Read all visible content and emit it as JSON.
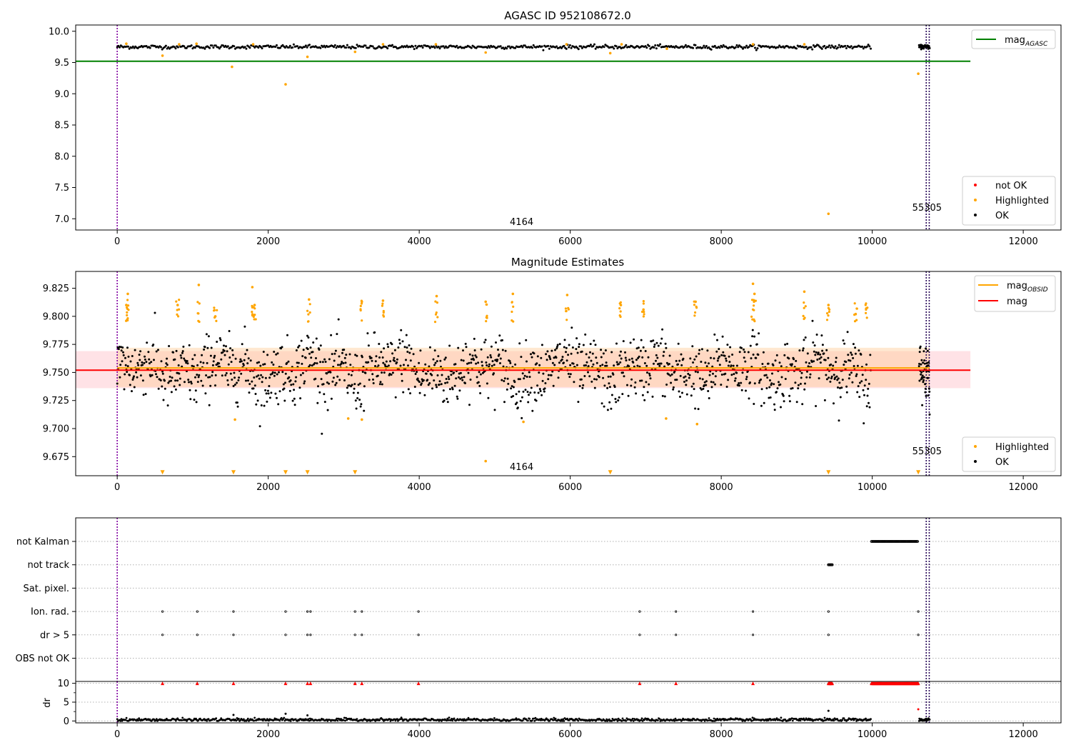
{
  "chart_data": [
    {
      "type": "scatter",
      "title": "AGASC ID 952108672.0",
      "xlim": [
        -550,
        12500
      ],
      "ylim": [
        6.82,
        10.1
      ],
      "xticks": [
        0,
        2000,
        4000,
        6000,
        8000,
        10000,
        12000
      ],
      "xtick_labels": [
        "0",
        "2000",
        "4000",
        "6000",
        "8000",
        "10000",
        "12000"
      ],
      "yticks": [
        7.0,
        7.5,
        8.0,
        8.5,
        9.0,
        9.5,
        10.0
      ],
      "ytick_labels": [
        "7.0",
        "7.5",
        "8.0",
        "8.5",
        "9.0",
        "9.5",
        "10.0"
      ],
      "grid": false,
      "vlines": [
        0,
        10715,
        10755
      ],
      "annotations": [
        {
          "text": "4164",
          "x": 5200,
          "y": 6.9
        },
        {
          "text": "55305",
          "x": 10530,
          "y": 7.13
        }
      ],
      "lines": [
        {
          "name": "magAGASC",
          "label_main": "mag",
          "label_sub": "AGASC",
          "color": "#008000",
          "x": [
            -550,
            11300
          ],
          "y": 9.52
        }
      ],
      "legend_upper": {
        "placement": "upper-right",
        "entries": [
          {
            "label_main": "mag",
            "label_sub": "AGASC",
            "color": "#008000"
          }
        ]
      },
      "legend_lower": {
        "placement": "lower-right",
        "entries": [
          {
            "label": "not OK",
            "color": "#ff0000"
          },
          {
            "label": "Highlighted",
            "color": "#ffa500"
          },
          {
            "label": "OK",
            "color": "#000000"
          }
        ]
      },
      "series": [
        {
          "name": "OK",
          "color": "#000000",
          "x_range": [
            0,
            9980
          ],
          "gap_range": [
            10620,
            10760
          ],
          "level": 9.75,
          "spread": 0.015
        },
        {
          "name": "Highlighted",
          "color": "#ffa500",
          "x": [
            120,
            600,
            820,
            1050,
            1520,
            1800,
            2230,
            2520,
            3150,
            3520,
            4220,
            4880,
            5950,
            6530,
            6680,
            7280,
            8420,
            9100,
            9420,
            10610
          ],
          "y": [
            9.8,
            9.61,
            9.79,
            9.8,
            9.43,
            9.79,
            9.15,
            9.59,
            9.67,
            9.79,
            9.79,
            9.66,
            9.79,
            9.65,
            9.79,
            9.72,
            9.79,
            9.79,
            7.08,
            9.32
          ]
        }
      ]
    },
    {
      "type": "scatter",
      "title": "Magnitude Estimates",
      "xlim": [
        -550,
        12500
      ],
      "ylim": [
        9.658,
        9.84
      ],
      "xticks": [
        0,
        2000,
        4000,
        6000,
        8000,
        10000,
        12000
      ],
      "xtick_labels": [
        "0",
        "2000",
        "4000",
        "6000",
        "8000",
        "10000",
        "12000"
      ],
      "yticks": [
        9.675,
        9.7,
        9.725,
        9.75,
        9.775,
        9.8,
        9.825
      ],
      "ytick_labels": [
        "9.675",
        "9.700",
        "9.725",
        "9.750",
        "9.775",
        "9.800",
        "9.825"
      ],
      "grid": false,
      "vlines": [
        0,
        10715,
        10755
      ],
      "annotations": [
        {
          "text": "4164",
          "x": 5200,
          "y": 9.663
        },
        {
          "text": "55305",
          "x": 10530,
          "y": 9.677
        }
      ],
      "lines": [
        {
          "name": "magOBSID",
          "label_main": "mag",
          "label_sub": "OBSID",
          "color": "#ffa500",
          "x": [
            0,
            10760
          ],
          "y": 9.754
        },
        {
          "name": "mag",
          "label_main": "mag",
          "color": "#ff0000",
          "x": [
            -550,
            11300
          ],
          "y": 9.752
        }
      ],
      "bands": [
        {
          "name": "mag band",
          "color": "#ffb6c1",
          "x": [
            -550,
            11300
          ],
          "y": [
            9.736,
            9.769
          ]
        },
        {
          "name": "magOBSID band",
          "color": "#ffcc99",
          "x": [
            0,
            10760
          ],
          "y": [
            9.737,
            9.772
          ]
        }
      ],
      "legend_upper": {
        "placement": "upper-right",
        "entries": [
          {
            "label_main": "mag",
            "label_sub": "OBSID",
            "color": "#ffa500"
          },
          {
            "label_main": "mag",
            "label_sub": "",
            "color": "#ff0000"
          }
        ]
      },
      "legend_lower": {
        "placement": "lower-right",
        "entries": [
          {
            "label": "Highlighted",
            "color": "#ffa500"
          },
          {
            "label": "OK",
            "color": "#000000"
          }
        ]
      },
      "series": [
        {
          "name": "OK",
          "color": "#000000",
          "x_range": [
            0,
            9980
          ],
          "gap_range": [
            10620,
            10760
          ],
          "level": 9.752,
          "spread": 0.014
        },
        {
          "name": "Highlighted",
          "color": "#ffa500",
          "x": [
            120,
            140,
            800,
            1080,
            1300,
            1790,
            1820,
            2540,
            3240,
            3520,
            4230,
            4880,
            5240,
            5960,
            6670,
            6970,
            7660,
            8420,
            8440,
            9100,
            9420,
            9780,
            9920,
            1560,
            3060,
            3240,
            5380,
            7270,
            7680,
            4880
          ],
          "y": [
            9.81,
            9.82,
            9.81,
            9.828,
            9.8,
            9.826,
            9.81,
            9.815,
            9.813,
            9.814,
            9.818,
            9.813,
            9.82,
            9.819,
            9.81,
            9.806,
            9.813,
            9.829,
            9.82,
            9.822,
            9.81,
            9.802,
            9.807,
            9.708,
            9.709,
            9.708,
            9.706,
            9.709,
            9.704,
            9.671
          ]
        },
        {
          "name": "Highlighted (below range)",
          "color": "#ffa500",
          "marker": "triangle-down",
          "x": [
            600,
            1540,
            2230,
            2520,
            3150,
            6530,
            9420,
            10610
          ],
          "y": 9.661
        }
      ]
    },
    {
      "type": "scatter",
      "title": "",
      "xlim": [
        -550,
        12500
      ],
      "categories": [
        "not Kalman",
        "not track",
        "Sat. pixel.",
        "Ion. rad.",
        "dr > 5",
        "OBS not OK"
      ],
      "grid": "horizontal-dotted",
      "vlines": [
        0,
        10715,
        10755
      ],
      "flags": [
        {
          "category": "not Kalman",
          "x_range": [
            9990,
            10600
          ]
        },
        {
          "category": "not track",
          "x_range": [
            9420,
            9470
          ]
        },
        {
          "category": "Ion. rad.",
          "x": [
            600,
            1060,
            1540,
            2230,
            2520,
            2560,
            3150,
            3240,
            3990,
            6920,
            7400,
            8420,
            9420,
            10610
          ]
        },
        {
          "category": "dr > 5",
          "x": [
            600,
            1060,
            1540,
            2230,
            2520,
            2560,
            3150,
            3240,
            3990,
            6920,
            7400,
            8420,
            9420,
            10610
          ]
        }
      ]
    },
    {
      "type": "scatter",
      "title": "",
      "ylabel": "dr",
      "xlim": [
        -550,
        12500
      ],
      "ylim": [
        -0.5,
        10.5
      ],
      "xticks": [
        0,
        2000,
        4000,
        6000,
        8000,
        10000,
        12000
      ],
      "xtick_labels": [
        "0",
        "2000",
        "4000",
        "6000",
        "8000",
        "10000",
        "12000"
      ],
      "yticks": [
        0,
        5,
        10
      ],
      "ytick_labels": [
        "0",
        "5",
        "10"
      ],
      "grid": "horizontal-dotted",
      "vlines": [
        0,
        10715,
        10755
      ],
      "series": [
        {
          "name": "OK",
          "color": "#000000",
          "x_range": [
            0,
            9980
          ],
          "gap_range": [
            10620,
            10760
          ],
          "level": 0.3,
          "spread": 0.2
        },
        {
          "name": "not OK (clipped)",
          "color": "#ff0000",
          "marker": "triangle-up",
          "x": [
            600,
            1060,
            1540,
            2230,
            2520,
            2560,
            3150,
            3240,
            3990,
            6920,
            7400,
            8420
          ],
          "y": 10
        },
        {
          "name": "not OK block",
          "color": "#ff0000",
          "x_range": [
            9420,
            9470
          ],
          "x_range2": [
            9990,
            10610
          ],
          "y": 10
        },
        {
          "name": "outliers",
          "color": "#000000",
          "x": [
            1540,
            2230,
            2520,
            9420
          ],
          "y": [
            1.6,
            1.9,
            1.5,
            2.7
          ]
        },
        {
          "name": "outliers red",
          "color": "#ff0000",
          "x": [
            10610
          ],
          "y": [
            3.1
          ]
        }
      ]
    }
  ]
}
